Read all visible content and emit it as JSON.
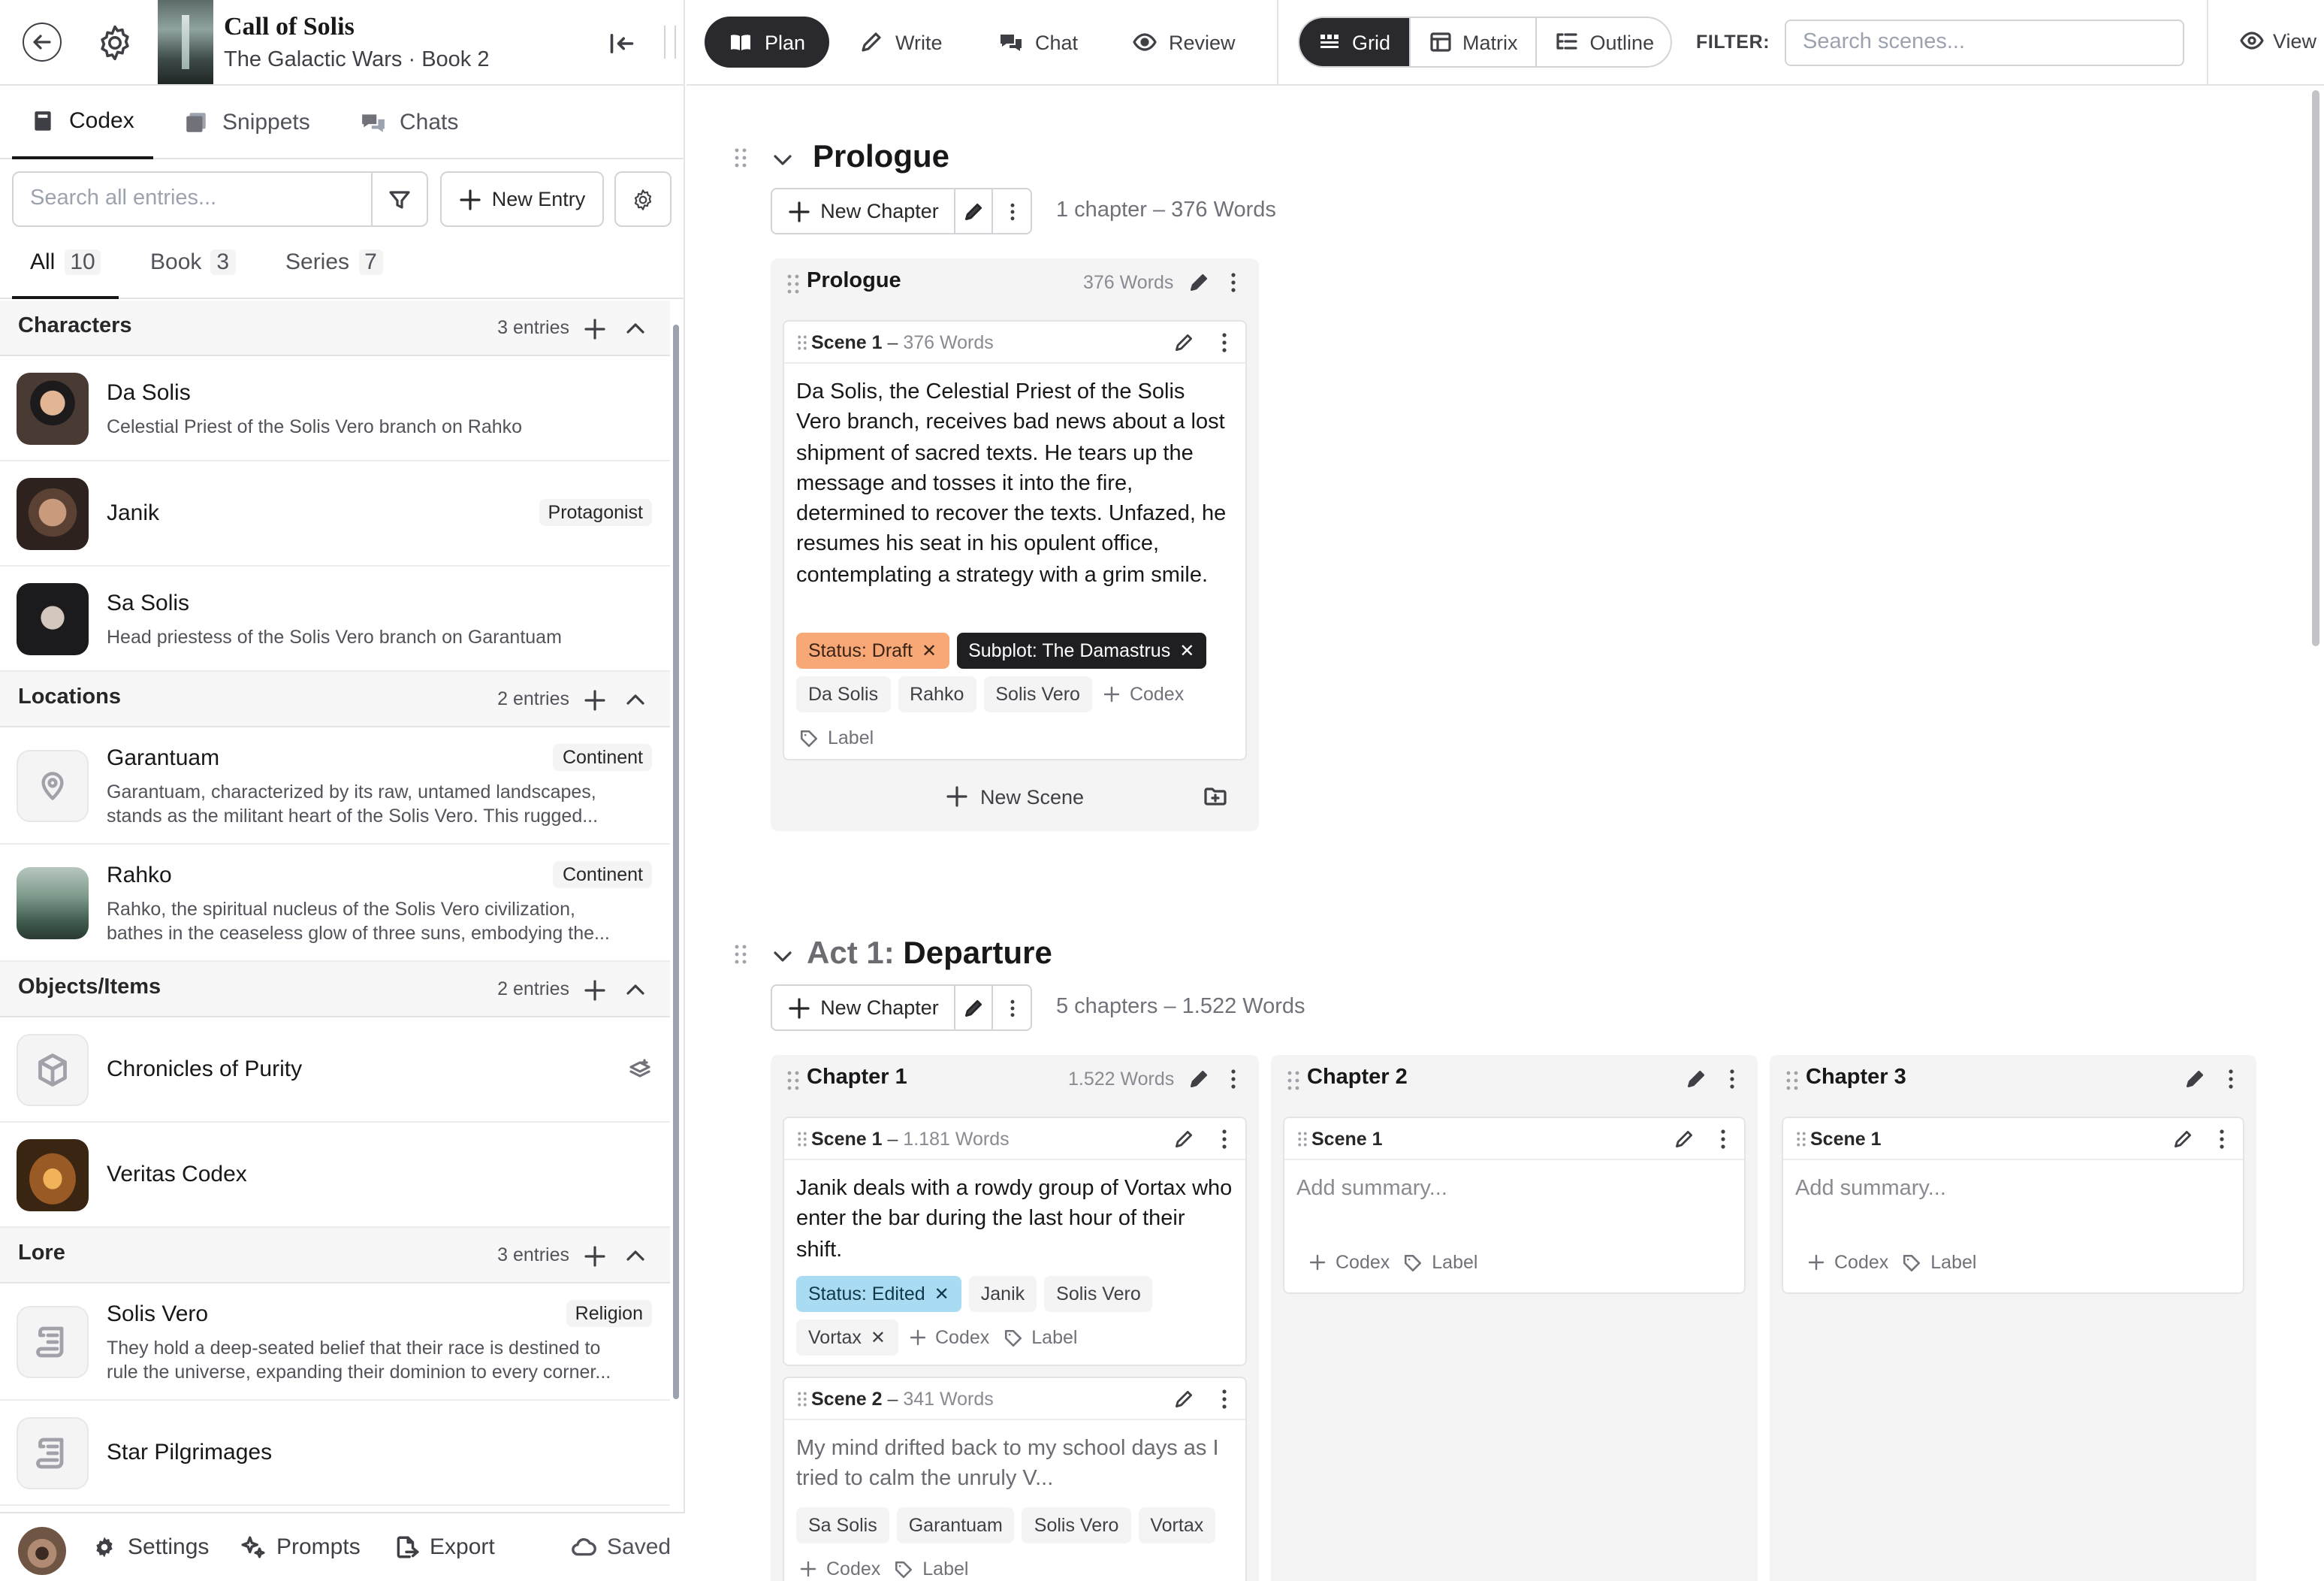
{
  "book": {
    "title": "Call of Solis",
    "subtitle": "The Galactic Wars · Book 2"
  },
  "sidebar": {
    "tabs": [
      {
        "label": "Codex",
        "icon": "book-icon",
        "active": true
      },
      {
        "label": "Snippets",
        "icon": "snippets-icon",
        "active": false
      },
      {
        "label": "Chats",
        "icon": "chats-icon",
        "active": false
      }
    ],
    "search": {
      "placeholder": "Search all entries..."
    },
    "new_entry_label": "New Entry",
    "filter_tabs": [
      {
        "label": "All",
        "count": "10",
        "active": true
      },
      {
        "label": "Book",
        "count": "3",
        "active": false
      },
      {
        "label": "Series",
        "count": "7",
        "active": false
      }
    ],
    "sections": [
      {
        "title": "Characters",
        "count": "3 entries",
        "entries": [
          {
            "name": "Da Solis",
            "desc": "Celestial Priest of the Solis Vero branch on Rahko",
            "badge": ""
          },
          {
            "name": "Janik",
            "desc": "",
            "badge": "Protagonist"
          },
          {
            "name": "Sa Solis",
            "desc": "Head priestess of the Solis Vero branch on Garantuam",
            "badge": ""
          }
        ]
      },
      {
        "title": "Locations",
        "count": "2 entries",
        "entries": [
          {
            "name": "Garantuam",
            "desc": "Garantuam, characterized by its raw, untamed landscapes, stands as the militant heart of the Solis Vero. This rugged...",
            "badge": "Continent"
          },
          {
            "name": "Rahko",
            "desc": "Rahko, the spiritual nucleus of the Solis Vero civilization, bathes in the ceaseless glow of three suns, embodying the...",
            "badge": "Continent"
          }
        ]
      },
      {
        "title": "Objects/Items",
        "count": "2 entries",
        "entries": [
          {
            "name": "Chronicles of Purity",
            "desc": "",
            "badge": ""
          },
          {
            "name": "Veritas Codex",
            "desc": "",
            "badge": ""
          }
        ]
      },
      {
        "title": "Lore",
        "count": "3 entries",
        "entries": [
          {
            "name": "Solis Vero",
            "desc": "They hold a deep-seated belief that their race is destined to rule the universe, expanding their dominion to every corner...",
            "badge": "Religion"
          },
          {
            "name": "Star Pilgrimages",
            "desc": "",
            "badge": ""
          }
        ]
      }
    ],
    "footer": {
      "settings": "Settings",
      "prompts": "Prompts",
      "export": "Export",
      "saved": "Saved"
    }
  },
  "topbar": {
    "modes": [
      {
        "label": "Plan",
        "active": true
      },
      {
        "label": "Write",
        "active": false
      },
      {
        "label": "Chat",
        "active": false
      },
      {
        "label": "Review",
        "active": false
      }
    ],
    "views": [
      {
        "label": "Grid",
        "active": true
      },
      {
        "label": "Matrix",
        "active": false
      },
      {
        "label": "Outline",
        "active": false
      }
    ],
    "filter_label": "FILTER:",
    "scene_search_placeholder": "Search scenes...",
    "view_label": "View"
  },
  "acts": [
    {
      "title_prefix": "",
      "title": "Prologue",
      "new_chapter": "New Chapter",
      "meta": "1 chapter  –  376 Words",
      "chapters": [
        {
          "title": "Prologue",
          "words": "376 Words",
          "scenes": [
            {
              "label": "Scene 1",
              "words": "376 Words",
              "summary": "Da Solis, the Celestial Priest of the Solis Vero branch, receives bad news about a lost shipment of sacred texts. He tears up the message and tosses it into the fire, determined to recover the texts. Unfazed, he resumes his seat in his opulent office, contemplating a strategy with a grim smile.",
              "status": "Status: Draft",
              "subplot": "Subplot: The Damastrus",
              "codex": [
                "Da Solis",
                "Rahko",
                "Solis Vero"
              ],
              "add_codex": "Codex",
              "add_label": "Label"
            }
          ],
          "new_scene": "New Scene"
        }
      ]
    },
    {
      "title_prefix": "Act 1:",
      "title": "Departure",
      "new_chapter": "New Chapter",
      "meta": "5 chapters  –  1.522 Words",
      "chapters": [
        {
          "title": "Chapter 1",
          "words": "1.522 Words",
          "scenes": [
            {
              "label": "Scene 1",
              "words": "1.181 Words",
              "summary": "Janik deals with a rowdy group of Vortax who enter the bar during the last hour of their shift.",
              "status": "Status: Edited",
              "codex": [
                "Janik",
                "Solis Vero",
                "Vortax"
              ],
              "add_codex": "Codex",
              "add_label": "Label"
            },
            {
              "label": "Scene 2",
              "words": "341 Words",
              "summary": "My mind drifted back to my school days as I tried to calm the unruly V...",
              "codex": [
                "Sa Solis",
                "Garantuam",
                "Solis Vero",
                "Vortax"
              ],
              "add_codex": "Codex",
              "add_label": "Label"
            }
          ]
        },
        {
          "title": "Chapter 2",
          "words": "",
          "scenes": [
            {
              "label": "Scene 1",
              "placeholder": "Add summary...",
              "add_codex": "Codex",
              "add_label": "Label"
            }
          ]
        },
        {
          "title": "Chapter 3",
          "words": "",
          "scenes": [
            {
              "label": "Scene 1",
              "placeholder": "Add summary...",
              "add_codex": "Codex",
              "add_label": "Label"
            }
          ]
        }
      ]
    }
  ],
  "colors": {
    "status_draft": "#f7a876",
    "status_edited": "#a9dcf2",
    "subplot": "#1f1f22",
    "active_pill": "#2a2a2e"
  }
}
